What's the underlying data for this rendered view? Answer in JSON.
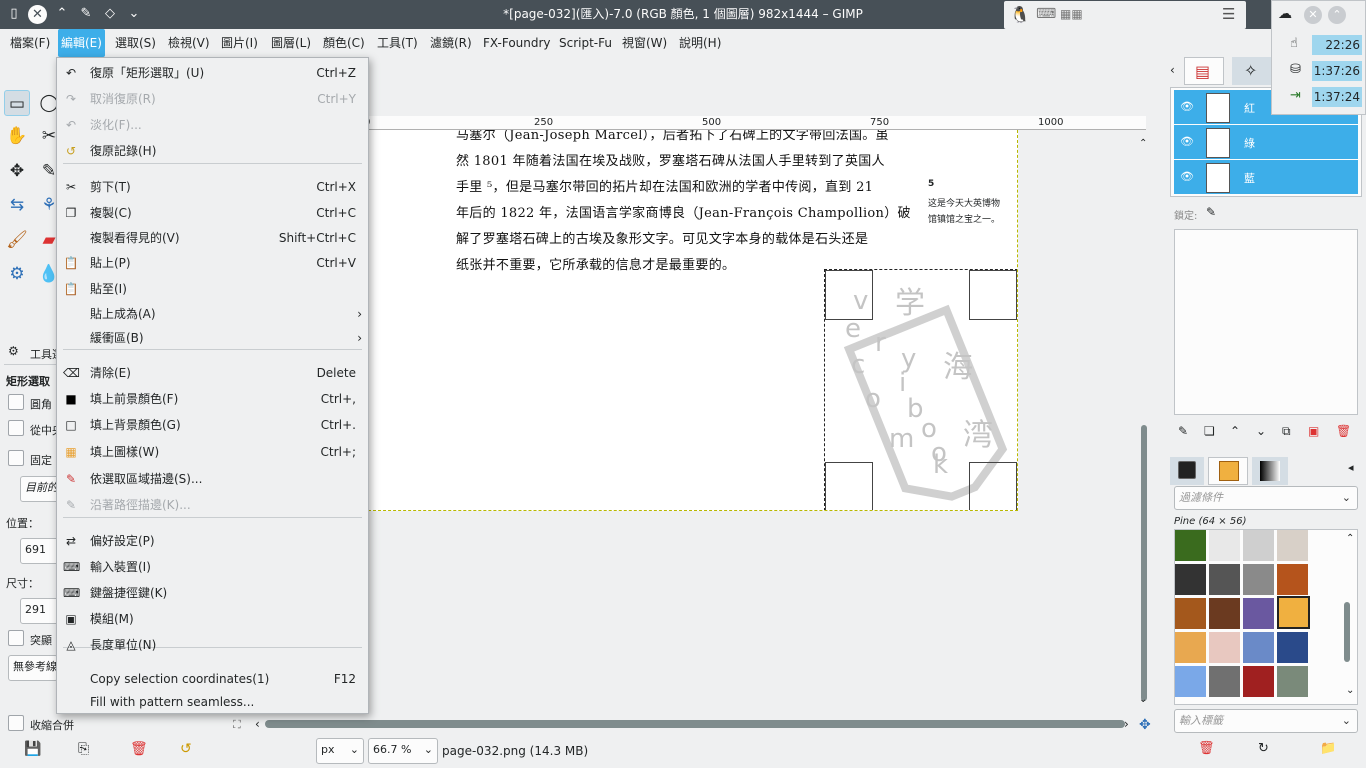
{
  "window": {
    "title": "*[page-032](匯入)-7.0 (RGB 顏色, 1 個圖層) 982x1444 – GIMP"
  },
  "tray": {
    "clock1": "22:26",
    "clock2": "1:37:26",
    "clock3": "1:37:24"
  },
  "menubar": [
    "檔案(F)",
    "編輯(E)",
    "選取(S)",
    "檢視(V)",
    "圖片(I)",
    "圖層(L)",
    "顏色(C)",
    "工具(T)",
    "濾鏡(R)",
    "FX-Foundry",
    "Script-Fu",
    "視窗(W)",
    "說明(H)"
  ],
  "edit_menu": [
    {
      "icon": "undo-icon",
      "glyph": "↶",
      "label": "復原「矩形選取」(U)",
      "shortcut": "Ctrl+Z",
      "disabled": false
    },
    {
      "icon": "redo-icon",
      "glyph": "↷",
      "label": "取消復原(R)",
      "shortcut": "Ctrl+Y",
      "disabled": true
    },
    {
      "icon": "fade-icon",
      "glyph": "↶",
      "label": "淡化(F)...",
      "shortcut": "",
      "disabled": true
    },
    {
      "icon": "undo-history-icon",
      "glyph": "↺",
      "label": "復原記錄(H)",
      "shortcut": "",
      "disabled": false
    },
    {
      "icon": "cut-icon",
      "glyph": "✂",
      "label": "剪下(T)",
      "shortcut": "Ctrl+X",
      "disabled": false
    },
    {
      "icon": "copy-icon",
      "glyph": "❐",
      "label": "複製(C)",
      "shortcut": "Ctrl+C",
      "disabled": false
    },
    {
      "icon": "",
      "glyph": "",
      "label": "複製看得見的(V)",
      "shortcut": "Shift+Ctrl+C",
      "disabled": false
    },
    {
      "icon": "paste-icon",
      "glyph": "📋",
      "label": "貼上(P)",
      "shortcut": "Ctrl+V",
      "disabled": false
    },
    {
      "icon": "paste-into-icon",
      "glyph": "📋",
      "label": "貼至(I)",
      "shortcut": "",
      "disabled": false
    },
    {
      "icon": "",
      "glyph": "",
      "label": "貼上成為(A)",
      "shortcut": "",
      "disabled": false,
      "submenu": true
    },
    {
      "icon": "",
      "glyph": "",
      "label": "緩衝區(B)",
      "shortcut": "",
      "disabled": false,
      "submenu": true
    },
    {
      "icon": "clear-icon",
      "glyph": "⌫",
      "label": "清除(E)",
      "shortcut": "Delete",
      "disabled": false
    },
    {
      "icon": "fill-fg-icon",
      "glyph": "■",
      "label": "填上前景顏色(F)",
      "shortcut": "Ctrl+,",
      "disabled": false
    },
    {
      "icon": "fill-bg-icon",
      "glyph": "□",
      "label": "填上背景顏色(G)",
      "shortcut": "Ctrl+.",
      "disabled": false
    },
    {
      "icon": "fill-pattern-icon",
      "glyph": "▦",
      "label": "填上圖樣(W)",
      "shortcut": "Ctrl+;",
      "disabled": false
    },
    {
      "icon": "stroke-selection-icon",
      "glyph": "✎",
      "label": "依選取區域描邊(S)...",
      "shortcut": "",
      "disabled": false
    },
    {
      "icon": "stroke-path-icon",
      "glyph": "✎",
      "label": "沿著路徑描邊(K)...",
      "shortcut": "",
      "disabled": true
    },
    {
      "icon": "preferences-icon",
      "glyph": "⇄",
      "label": "偏好設定(P)",
      "shortcut": "",
      "disabled": false
    },
    {
      "icon": "input-devices-icon",
      "glyph": "⌨",
      "label": "輸入裝置(I)",
      "shortcut": "",
      "disabled": false
    },
    {
      "icon": "keyboard-shortcuts-icon",
      "glyph": "⌨",
      "label": "鍵盤捷徑鍵(K)",
      "shortcut": "",
      "disabled": false
    },
    {
      "icon": "modules-icon",
      "glyph": "▣",
      "label": "模組(M)",
      "shortcut": "",
      "disabled": false
    },
    {
      "icon": "units-icon",
      "glyph": "◬",
      "label": "長度單位(N)",
      "shortcut": "",
      "disabled": false
    },
    {
      "icon": "",
      "glyph": "",
      "label": "Copy selection coordinates(1)",
      "shortcut": "F12",
      "disabled": false
    },
    {
      "icon": "",
      "glyph": "",
      "label": "Fill with pattern seamless...",
      "shortcut": "",
      "disabled": false
    }
  ],
  "toolbox": {
    "panel_title": "工具選",
    "tool_name": "矩形選取",
    "opt_rounded": "圓角",
    "opt_center": "從中央",
    "opt_fixed": "固定",
    "fixed_value": "目前的",
    "position_label": "位置：",
    "position_value": "691",
    "size_label": "尺寸：",
    "size_value": "291",
    "highlight": "突顯",
    "guides": "無參考線",
    "autoshrink": "收縮合併"
  },
  "ruler": {
    "t250": "250",
    "t500": "500",
    "t750": "750",
    "t1000": "1000",
    "t0": "0"
  },
  "document": {
    "line1": "马塞尔（Jean-Joseph Marcel），后者拓下了石碑上的文字带回法国。虽",
    "line2": "然 1801 年随着法国在埃及战败，罗塞塔石碑从法国人手里转到了英国人",
    "line3": "手里 ⁵，但是马塞尔带回的拓片却在法国和欧洲的学者中传阅，直到 21",
    "line4": "年后的 1822 年，法国语言学家商博良（Jean-François Champollion）破",
    "line5": "解了罗塞塔石碑上的古埃及象形文字。可见文字本身的载体是石头还是",
    "line6": "纸张并不重要，它所承载的信息才是最重要的。",
    "footnote_num": "5",
    "footnote1": "这是今天大英博物",
    "footnote2": "馆镇馆之宝之一。",
    "watermark_latin": [
      "v",
      "e",
      "r",
      "y",
      "i",
      "c",
      "o",
      "b",
      "o",
      "m",
      "o",
      "k"
    ],
    "watermark_cjk": [
      "学",
      "海",
      "湾"
    ]
  },
  "statusbar": {
    "unit": "px",
    "zoom": "66.7 %",
    "file": "page-032.png (14.3 MB)"
  },
  "layers": {
    "items": [
      "紅",
      "綠",
      "藍"
    ],
    "lock_label": "鎖定:"
  },
  "patterns": {
    "filter_placeholder": "過濾條件",
    "selected_name": "Pine (64 × 56)",
    "tag_placeholder": "輸入標籤"
  },
  "colors": {
    "accent": "#3daee9",
    "titlebar": "#475057"
  }
}
